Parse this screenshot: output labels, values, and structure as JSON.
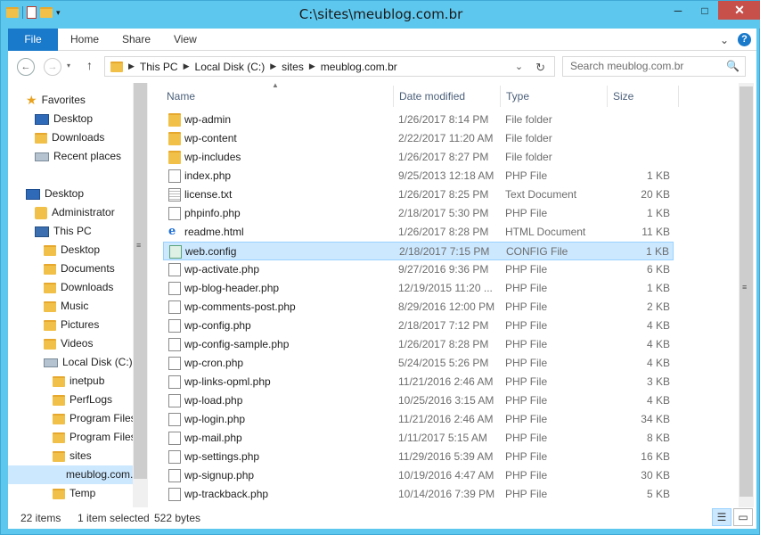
{
  "window": {
    "title": "C:\\sites\\meublog.com.br",
    "min": "─",
    "max": "□",
    "close": "✕"
  },
  "ribbon": {
    "tabs": [
      "File",
      "Home",
      "Share",
      "View"
    ],
    "expand": "⌄",
    "help": "?"
  },
  "address": {
    "back": "←",
    "forward": "→",
    "up": "↑",
    "segments": [
      "This PC",
      "Local Disk (C:)",
      "sites",
      "meublog.com.br"
    ],
    "dropdown": "⌄",
    "refresh": "↻",
    "search_placeholder": "Search meublog.com.br",
    "search_icon": "🔍"
  },
  "nav": {
    "items": [
      {
        "label": "Favorites",
        "icon": "star-icon"
      },
      {
        "label": "Desktop",
        "icon": "desktop-icon"
      },
      {
        "label": "Downloads",
        "icon": "downloads-icon"
      },
      {
        "label": "Recent places",
        "icon": "recent-places-icon"
      },
      {
        "label": "Desktop",
        "icon": "desktop-icon"
      },
      {
        "label": "Administrator",
        "icon": "user-folder-icon"
      },
      {
        "label": "This PC",
        "icon": "computer-icon"
      },
      {
        "label": "Desktop",
        "icon": "folder-icon"
      },
      {
        "label": "Documents",
        "icon": "folder-icon"
      },
      {
        "label": "Downloads",
        "icon": "folder-icon"
      },
      {
        "label": "Music",
        "icon": "folder-icon"
      },
      {
        "label": "Pictures",
        "icon": "folder-icon"
      },
      {
        "label": "Videos",
        "icon": "folder-icon"
      },
      {
        "label": "Local Disk (C:)",
        "icon": "drive-icon"
      },
      {
        "label": "inetpub",
        "icon": "folder-icon"
      },
      {
        "label": "PerfLogs",
        "icon": "folder-icon"
      },
      {
        "label": "Program Files",
        "icon": "folder-icon"
      },
      {
        "label": "Program Files",
        "icon": "folder-icon"
      },
      {
        "label": "sites",
        "icon": "folder-icon"
      },
      {
        "label": "meublog.com.br",
        "icon": "folder-icon",
        "selected": true
      },
      {
        "label": "Temp",
        "icon": "folder-icon"
      }
    ]
  },
  "columns": [
    "Name",
    "Date modified",
    "Type",
    "Size"
  ],
  "files": [
    {
      "name": "wp-admin",
      "date": "1/26/2017 8:14 PM",
      "type": "File folder",
      "size": "",
      "icon": "folder"
    },
    {
      "name": "wp-content",
      "date": "2/22/2017 11:20 AM",
      "type": "File folder",
      "size": "",
      "icon": "folder"
    },
    {
      "name": "wp-includes",
      "date": "1/26/2017 8:27 PM",
      "type": "File folder",
      "size": "",
      "icon": "folder"
    },
    {
      "name": "index.php",
      "date": "9/25/2013 12:18 AM",
      "type": "PHP File",
      "size": "1 KB",
      "icon": "php"
    },
    {
      "name": "license.txt",
      "date": "1/26/2017 8:25 PM",
      "type": "Text Document",
      "size": "20 KB",
      "icon": "txt"
    },
    {
      "name": "phpinfo.php",
      "date": "2/18/2017 5:30 PM",
      "type": "PHP File",
      "size": "1 KB",
      "icon": "php"
    },
    {
      "name": "readme.html",
      "date": "1/26/2017 8:28 PM",
      "type": "HTML Document",
      "size": "11 KB",
      "icon": "html"
    },
    {
      "name": "web.config",
      "date": "2/18/2017 7:15 PM",
      "type": "CONFIG File",
      "size": "1 KB",
      "icon": "config",
      "selected": true
    },
    {
      "name": "wp-activate.php",
      "date": "9/27/2016 9:36 PM",
      "type": "PHP File",
      "size": "6 KB",
      "icon": "php"
    },
    {
      "name": "wp-blog-header.php",
      "date": "12/19/2015 11:20 ...",
      "type": "PHP File",
      "size": "1 KB",
      "icon": "php"
    },
    {
      "name": "wp-comments-post.php",
      "date": "8/29/2016 12:00 PM",
      "type": "PHP File",
      "size": "2 KB",
      "icon": "php"
    },
    {
      "name": "wp-config.php",
      "date": "2/18/2017 7:12 PM",
      "type": "PHP File",
      "size": "4 KB",
      "icon": "php"
    },
    {
      "name": "wp-config-sample.php",
      "date": "1/26/2017 8:28 PM",
      "type": "PHP File",
      "size": "4 KB",
      "icon": "php"
    },
    {
      "name": "wp-cron.php",
      "date": "5/24/2015 5:26 PM",
      "type": "PHP File",
      "size": "4 KB",
      "icon": "php"
    },
    {
      "name": "wp-links-opml.php",
      "date": "11/21/2016 2:46 AM",
      "type": "PHP File",
      "size": "3 KB",
      "icon": "php"
    },
    {
      "name": "wp-load.php",
      "date": "10/25/2016 3:15 AM",
      "type": "PHP File",
      "size": "4 KB",
      "icon": "php"
    },
    {
      "name": "wp-login.php",
      "date": "11/21/2016 2:46 AM",
      "type": "PHP File",
      "size": "34 KB",
      "icon": "php"
    },
    {
      "name": "wp-mail.php",
      "date": "1/11/2017 5:15 AM",
      "type": "PHP File",
      "size": "8 KB",
      "icon": "php"
    },
    {
      "name": "wp-settings.php",
      "date": "11/29/2016 5:39 AM",
      "type": "PHP File",
      "size": "16 KB",
      "icon": "php"
    },
    {
      "name": "wp-signup.php",
      "date": "10/19/2016 4:47 AM",
      "type": "PHP File",
      "size": "30 KB",
      "icon": "php"
    },
    {
      "name": "wp-trackback.php",
      "date": "10/14/2016 7:39 PM",
      "type": "PHP File",
      "size": "5 KB",
      "icon": "php"
    }
  ],
  "status": {
    "count": "22 items",
    "selected": "1 item selected",
    "bytes": "522 bytes"
  }
}
